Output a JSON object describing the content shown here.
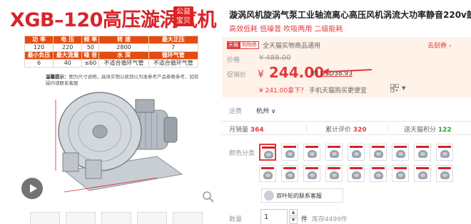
{
  "image_panel": {
    "banner_title": "XGB–120高压漩涡气机",
    "badge_line1": "公益",
    "badge_line2": "宝贝",
    "spec_headers_1": [
      "功 率",
      "电 压",
      "频 率",
      "转 速",
      "最大正压"
    ],
    "spec_values_1": [
      "120",
      "220",
      "50",
      "2800",
      "7"
    ],
    "spec_headers_2": [
      "最小负压",
      "最大流量",
      "噪 音",
      "水 深",
      "循环气管"
    ],
    "spec_values_2": [
      "6",
      "40",
      "≤60",
      "不适合循环气管",
      "不适合循环气管"
    ],
    "note_label": "温馨提示：",
    "note_text": "图为尺寸说明，具体实物以收到以为准参考产品参数参考，如有疑问请联系客服"
  },
  "product": {
    "title": "漩涡风机旋涡气泵工业轴流离心高压风机涡流大功率静音220v鼓风机",
    "subtitle": "高效低耗 低噪音 吹吸两用 二级能耗"
  },
  "price_box": {
    "tag1": "天猫",
    "tag2": "购物券",
    "store_text": "全天猫实物商品通用",
    "gift_link": "去刮券",
    "price_label": "价格",
    "original_price": "¥ 488.00",
    "promo_label": "促销价",
    "promo_currency": "¥",
    "promo_amount": "244.00",
    "usd_prefix": "约",
    "usd_value": "USD38.93",
    "coupon_price": "¥ 241.00",
    "coupon_text": "拿下？",
    "coupon_muted": "手机天猫购买更便宜"
  },
  "shipping": {
    "label": "运费",
    "city": "杭州"
  },
  "stats": {
    "sales_label": "月销量",
    "sales": "364",
    "reviews_label": "累计评价",
    "reviews": "320",
    "points_label": "送天猫积分",
    "points": "122"
  },
  "options": {
    "color_label": "颜色分类",
    "extra_sku": "双叶轮的联系客服"
  },
  "quantity": {
    "label": "数量",
    "value": "1",
    "unit": "件",
    "stock": "库存4499件"
  },
  "colors": {
    "accent": "#e4393c",
    "banner_red": "#d8232a",
    "table_header": "#e34d0f",
    "points_green": "#2aa72a"
  }
}
